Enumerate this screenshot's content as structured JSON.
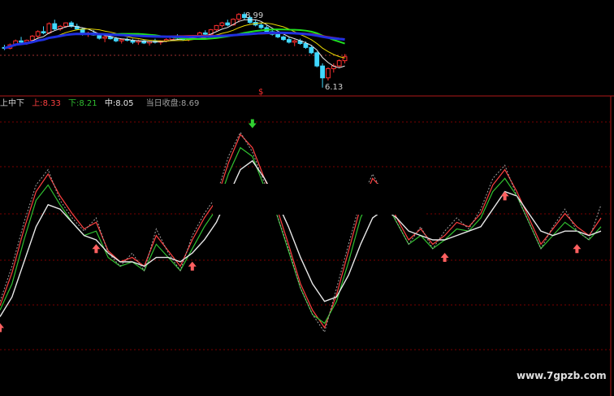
{
  "colors": {
    "background": "#000000",
    "frame_red": "#b01818",
    "grid_red": "#7a0000",
    "candle_up": "#ff3030",
    "candle_down": "#40d8ff",
    "ma_white": "#e8e8e8",
    "ma_yellow": "#e8d800",
    "ma_green": "#20e020",
    "ma_red": "#e02020",
    "ma_blue": "#2030e0",
    "band_upper": "#ff4040",
    "band_lower": "#30c030",
    "band_mid": "#e8e8e8",
    "close_gray": "#a0a0a0",
    "up_arrow": "#ff6060",
    "down_arrow": "#30d030"
  },
  "price_panel": {
    "high_label": "8.99",
    "low_label": "6.13",
    "marker_label": "$"
  },
  "indicator_panel": {
    "title": "上中下",
    "upper_label": "上:",
    "upper_value": "8.33",
    "lower_label": "下:",
    "lower_value": "8.21",
    "mid_label": "中:",
    "mid_value": "8.05",
    "close_label": "当日收盘:",
    "close_value": "8.69"
  },
  "watermark": "www.7gpzb.com",
  "chart_data": [
    {
      "type": "candlestick",
      "labels": {
        "high": "8.99",
        "low": "6.13"
      },
      "ylim": [
        6.0,
        9.2
      ],
      "candles": [
        {
          "o": 7.65,
          "h": 7.75,
          "l": 7.55,
          "c": 7.62
        },
        {
          "o": 7.62,
          "h": 7.8,
          "l": 7.58,
          "c": 7.75
        },
        {
          "o": 7.75,
          "h": 7.95,
          "l": 7.7,
          "c": 7.9
        },
        {
          "o": 7.9,
          "h": 8.05,
          "l": 7.82,
          "c": 7.85
        },
        {
          "o": 7.85,
          "h": 7.95,
          "l": 7.75,
          "c": 7.92
        },
        {
          "o": 7.92,
          "h": 8.12,
          "l": 7.88,
          "c": 8.08
        },
        {
          "o": 8.08,
          "h": 8.3,
          "l": 8.0,
          "c": 8.25
        },
        {
          "o": 8.25,
          "h": 8.45,
          "l": 8.15,
          "c": 8.2
        },
        {
          "o": 8.2,
          "h": 8.6,
          "l": 8.15,
          "c": 8.55
        },
        {
          "o": 8.55,
          "h": 8.7,
          "l": 8.3,
          "c": 8.35
        },
        {
          "o": 8.35,
          "h": 8.5,
          "l": 8.28,
          "c": 8.45
        },
        {
          "o": 8.45,
          "h": 8.6,
          "l": 8.4,
          "c": 8.58
        },
        {
          "o": 8.58,
          "h": 8.65,
          "l": 8.4,
          "c": 8.45
        },
        {
          "o": 8.45,
          "h": 8.55,
          "l": 8.3,
          "c": 8.35
        },
        {
          "o": 8.35,
          "h": 8.4,
          "l": 8.1,
          "c": 8.15
        },
        {
          "o": 8.15,
          "h": 8.25,
          "l": 8.05,
          "c": 8.2
        },
        {
          "o": 8.2,
          "h": 8.3,
          "l": 8.1,
          "c": 8.12
        },
        {
          "o": 8.12,
          "h": 8.2,
          "l": 7.95,
          "c": 8.0
        },
        {
          "o": 8.0,
          "h": 8.1,
          "l": 7.85,
          "c": 8.05
        },
        {
          "o": 8.05,
          "h": 8.15,
          "l": 7.95,
          "c": 7.98
        },
        {
          "o": 7.98,
          "h": 8.05,
          "l": 7.85,
          "c": 7.9
        },
        {
          "o": 7.9,
          "h": 7.98,
          "l": 7.8,
          "c": 7.95
        },
        {
          "o": 7.95,
          "h": 8.02,
          "l": 7.88,
          "c": 7.92
        },
        {
          "o": 7.92,
          "h": 7.98,
          "l": 7.78,
          "c": 7.85
        },
        {
          "o": 7.85,
          "h": 7.95,
          "l": 7.75,
          "c": 7.9
        },
        {
          "o": 7.9,
          "h": 7.95,
          "l": 7.78,
          "c": 7.82
        },
        {
          "o": 7.82,
          "h": 7.9,
          "l": 7.72,
          "c": 7.88
        },
        {
          "o": 7.88,
          "h": 7.98,
          "l": 7.8,
          "c": 7.85
        },
        {
          "o": 7.85,
          "h": 7.92,
          "l": 7.75,
          "c": 7.9
        },
        {
          "o": 7.9,
          "h": 8.0,
          "l": 7.85,
          "c": 7.95
        },
        {
          "o": 7.95,
          "h": 8.1,
          "l": 7.9,
          "c": 8.05
        },
        {
          "o": 8.05,
          "h": 8.15,
          "l": 7.95,
          "c": 8.0
        },
        {
          "o": 8.0,
          "h": 8.08,
          "l": 7.9,
          "c": 7.95
        },
        {
          "o": 7.95,
          "h": 8.05,
          "l": 7.88,
          "c": 8.02
        },
        {
          "o": 8.02,
          "h": 8.12,
          "l": 7.95,
          "c": 8.1
        },
        {
          "o": 8.1,
          "h": 8.25,
          "l": 8.05,
          "c": 8.2
        },
        {
          "o": 8.2,
          "h": 8.3,
          "l": 8.1,
          "c": 8.15
        },
        {
          "o": 8.15,
          "h": 8.35,
          "l": 8.12,
          "c": 8.32
        },
        {
          "o": 8.32,
          "h": 8.5,
          "l": 8.28,
          "c": 8.48
        },
        {
          "o": 8.48,
          "h": 8.62,
          "l": 8.4,
          "c": 8.58
        },
        {
          "o": 8.58,
          "h": 8.7,
          "l": 8.45,
          "c": 8.5
        },
        {
          "o": 8.5,
          "h": 8.75,
          "l": 8.48,
          "c": 8.72
        },
        {
          "o": 8.72,
          "h": 8.95,
          "l": 8.6,
          "c": 8.9
        },
        {
          "o": 8.9,
          "h": 8.99,
          "l": 8.7,
          "c": 8.78
        },
        {
          "o": 8.78,
          "h": 8.85,
          "l": 8.55,
          "c": 8.6
        },
        {
          "o": 8.6,
          "h": 8.7,
          "l": 8.45,
          "c": 8.5
        },
        {
          "o": 8.5,
          "h": 8.6,
          "l": 8.35,
          "c": 8.4
        },
        {
          "o": 8.4,
          "h": 8.48,
          "l": 8.2,
          "c": 8.25
        },
        {
          "o": 8.25,
          "h": 8.35,
          "l": 8.1,
          "c": 8.15
        },
        {
          "o": 8.15,
          "h": 8.25,
          "l": 8.0,
          "c": 8.05
        },
        {
          "o": 8.05,
          "h": 8.1,
          "l": 7.9,
          "c": 7.95
        },
        {
          "o": 7.95,
          "h": 8.05,
          "l": 7.8,
          "c": 7.85
        },
        {
          "o": 7.85,
          "h": 7.95,
          "l": 7.7,
          "c": 7.9
        },
        {
          "o": 7.9,
          "h": 7.98,
          "l": 7.75,
          "c": 7.8
        },
        {
          "o": 7.8,
          "h": 7.88,
          "l": 7.6,
          "c": 7.65
        },
        {
          "o": 7.65,
          "h": 7.72,
          "l": 7.4,
          "c": 7.45
        },
        {
          "o": 7.45,
          "h": 7.5,
          "l": 6.9,
          "c": 6.95
        },
        {
          "o": 6.95,
          "h": 7.05,
          "l": 6.13,
          "c": 6.5
        },
        {
          "o": 6.5,
          "h": 6.9,
          "l": 6.4,
          "c": 6.85
        },
        {
          "o": 6.85,
          "h": 7.05,
          "l": 6.7,
          "c": 6.95
        },
        {
          "o": 6.95,
          "h": 7.2,
          "l": 6.9,
          "c": 7.15
        },
        {
          "o": 7.15,
          "h": 7.4,
          "l": 7.05,
          "c": 7.3
        }
      ]
    },
    {
      "type": "line",
      "ylim": [
        0,
        100
      ],
      "series": [
        {
          "name": "上",
          "values": [
            20,
            35,
            55,
            72,
            80,
            70,
            62,
            55,
            58,
            45,
            40,
            42,
            38,
            52,
            45,
            38,
            50,
            60,
            68,
            85,
            98,
            92,
            78,
            65,
            48,
            30,
            18,
            10,
            25,
            45,
            65,
            78,
            72,
            60,
            50,
            55,
            48,
            52,
            58,
            56,
            62,
            75,
            82,
            72,
            60,
            48,
            55,
            62,
            56,
            52,
            60
          ]
        },
        {
          "name": "下",
          "values": [
            18,
            30,
            50,
            68,
            75,
            66,
            58,
            52,
            54,
            42,
            38,
            40,
            36,
            48,
            42,
            36,
            46,
            56,
            64,
            80,
            92,
            88,
            74,
            62,
            45,
            28,
            16,
            12,
            22,
            40,
            60,
            72,
            68,
            58,
            48,
            52,
            46,
            50,
            55,
            54,
            60,
            72,
            78,
            70,
            58,
            46,
            52,
            58,
            54,
            50,
            56
          ]
        },
        {
          "name": "中",
          "values": [
            15,
            24,
            40,
            56,
            66,
            64,
            58,
            52,
            50,
            44,
            40,
            40,
            38,
            42,
            42,
            40,
            44,
            50,
            58,
            70,
            82,
            86,
            78,
            68,
            56,
            42,
            30,
            22,
            24,
            34,
            48,
            60,
            64,
            60,
            54,
            52,
            50,
            50,
            52,
            54,
            56,
            64,
            72,
            70,
            62,
            54,
            52,
            54,
            54,
            52,
            54
          ]
        },
        {
          "name": "当日收盘",
          "values": [
            22,
            38,
            58,
            75,
            82,
            68,
            60,
            54,
            60,
            44,
            38,
            44,
            36,
            55,
            44,
            36,
            52,
            62,
            70,
            88,
            99,
            90,
            76,
            62,
            46,
            28,
            16,
            8,
            28,
            48,
            68,
            80,
            70,
            58,
            48,
            56,
            46,
            54,
            60,
            55,
            64,
            78,
            84,
            70,
            58,
            46,
            56,
            64,
            54,
            50,
            66
          ]
        }
      ],
      "up_arrows": [
        0,
        8,
        16,
        31,
        37,
        42,
        48
      ],
      "down_arrows": [
        21,
        35
      ]
    }
  ]
}
